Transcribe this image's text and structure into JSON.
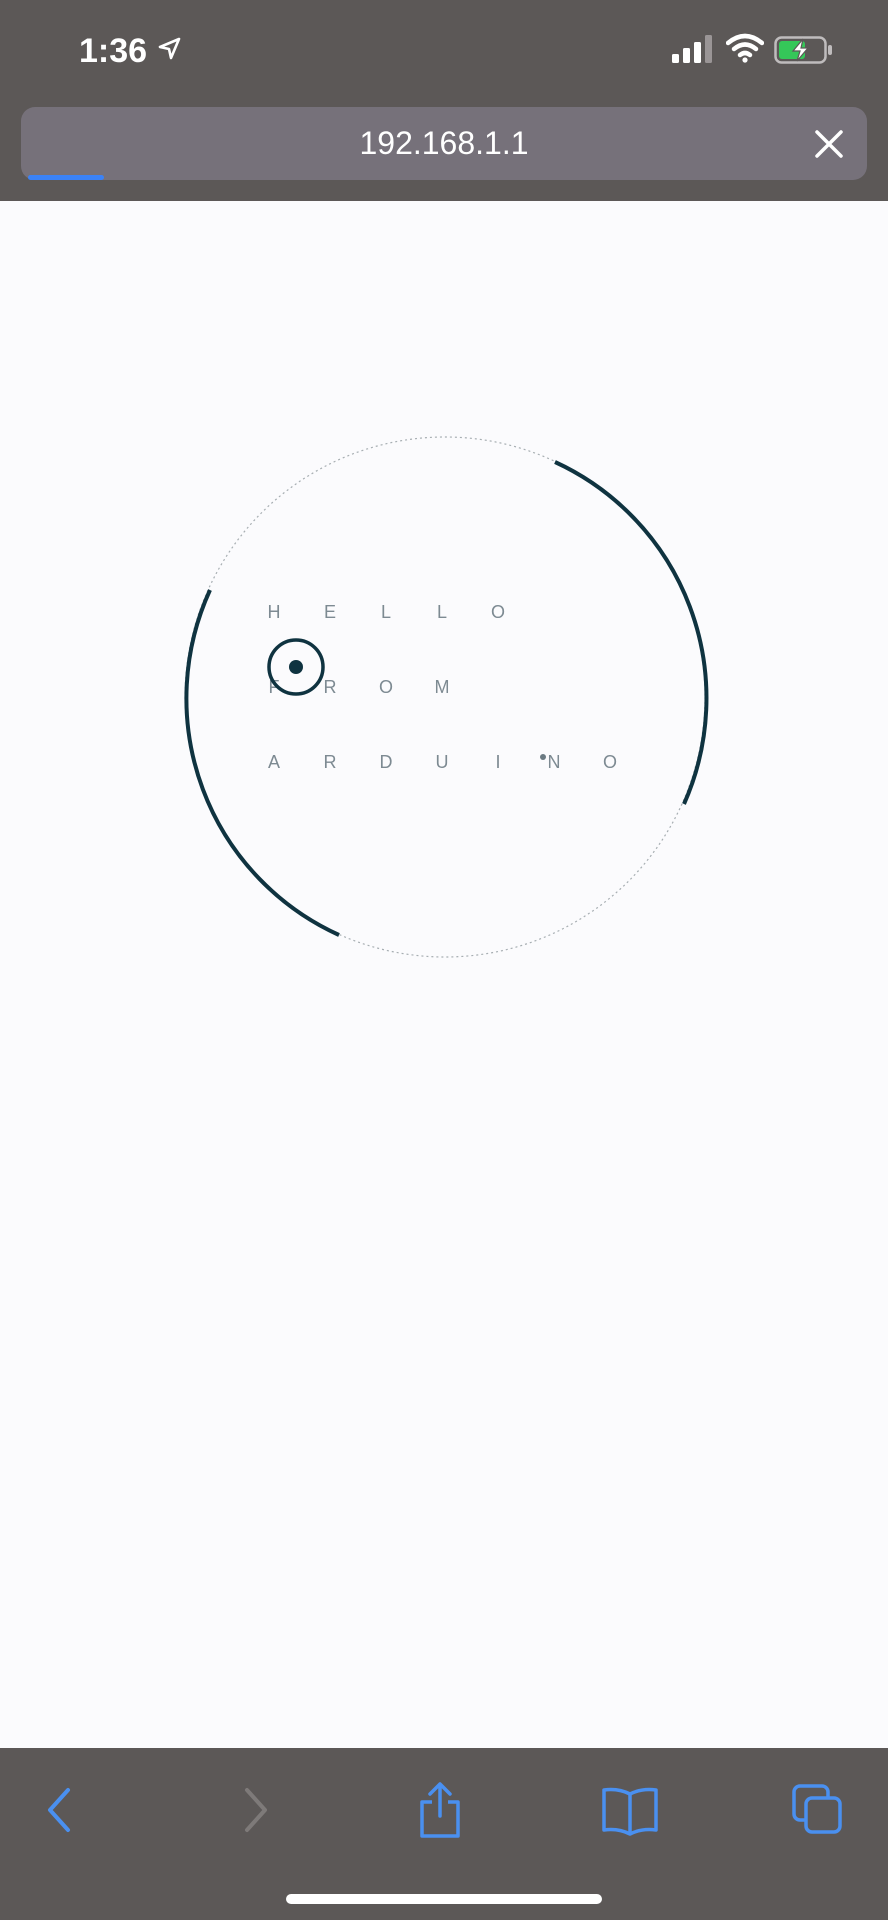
{
  "status_bar": {
    "time": "1:36",
    "icons": [
      "location-arrow-icon",
      "cellular-signal-icon",
      "wifi-icon",
      "battery-charging-icon"
    ]
  },
  "browser": {
    "url": "192.168.1.1",
    "load_progress": 0.09,
    "toolbar_icons": [
      "back-icon",
      "forward-icon",
      "share-icon",
      "bookmarks-icon",
      "tabs-icon"
    ]
  },
  "page": {
    "rows": [
      [
        "H",
        "E",
        "L",
        "L",
        "O"
      ],
      [
        "F",
        "R",
        "O",
        "M"
      ],
      [
        "A",
        "R",
        "D",
        "U",
        "I",
        "N",
        "O"
      ]
    ]
  },
  "colors": {
    "chrome_bg": "#5c5857",
    "url_bar_bg": "#76717a",
    "accent_blue": "#3b82f6",
    "ring_dark": "#0f3340",
    "letter_gray": "#7d8a92",
    "page_bg": "#fbfbfd"
  }
}
